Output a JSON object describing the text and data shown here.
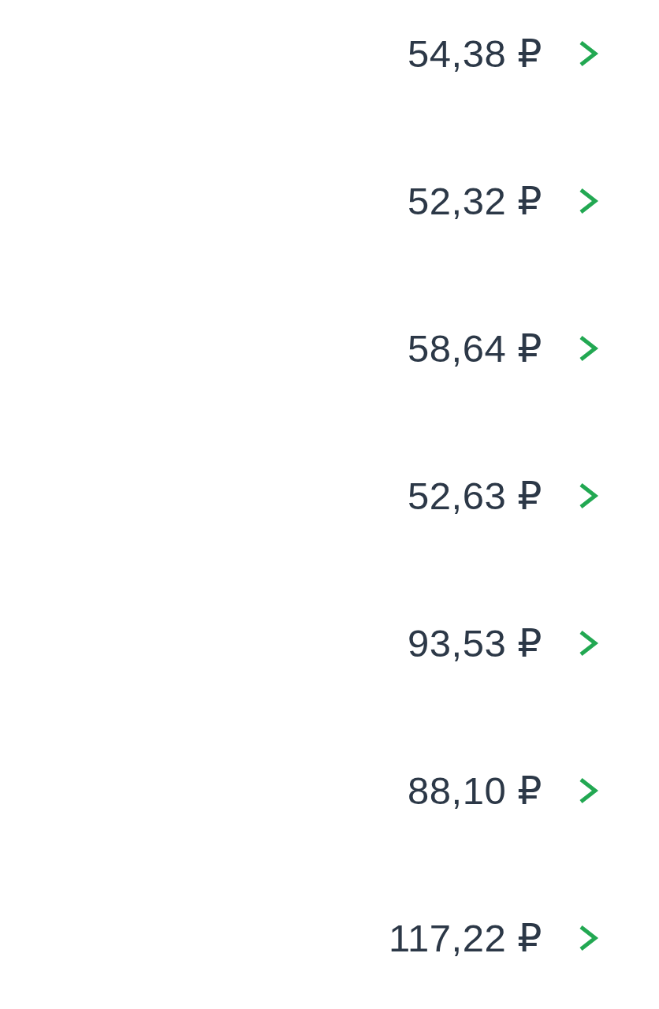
{
  "rows": [
    {
      "price": "54,38 ₽"
    },
    {
      "price": "52,32 ₽"
    },
    {
      "price": "58,64 ₽"
    },
    {
      "price": "52,63 ₽"
    },
    {
      "price": "93,53 ₽"
    },
    {
      "price": "88,10 ₽"
    },
    {
      "price": "117,22 ₽"
    }
  ]
}
